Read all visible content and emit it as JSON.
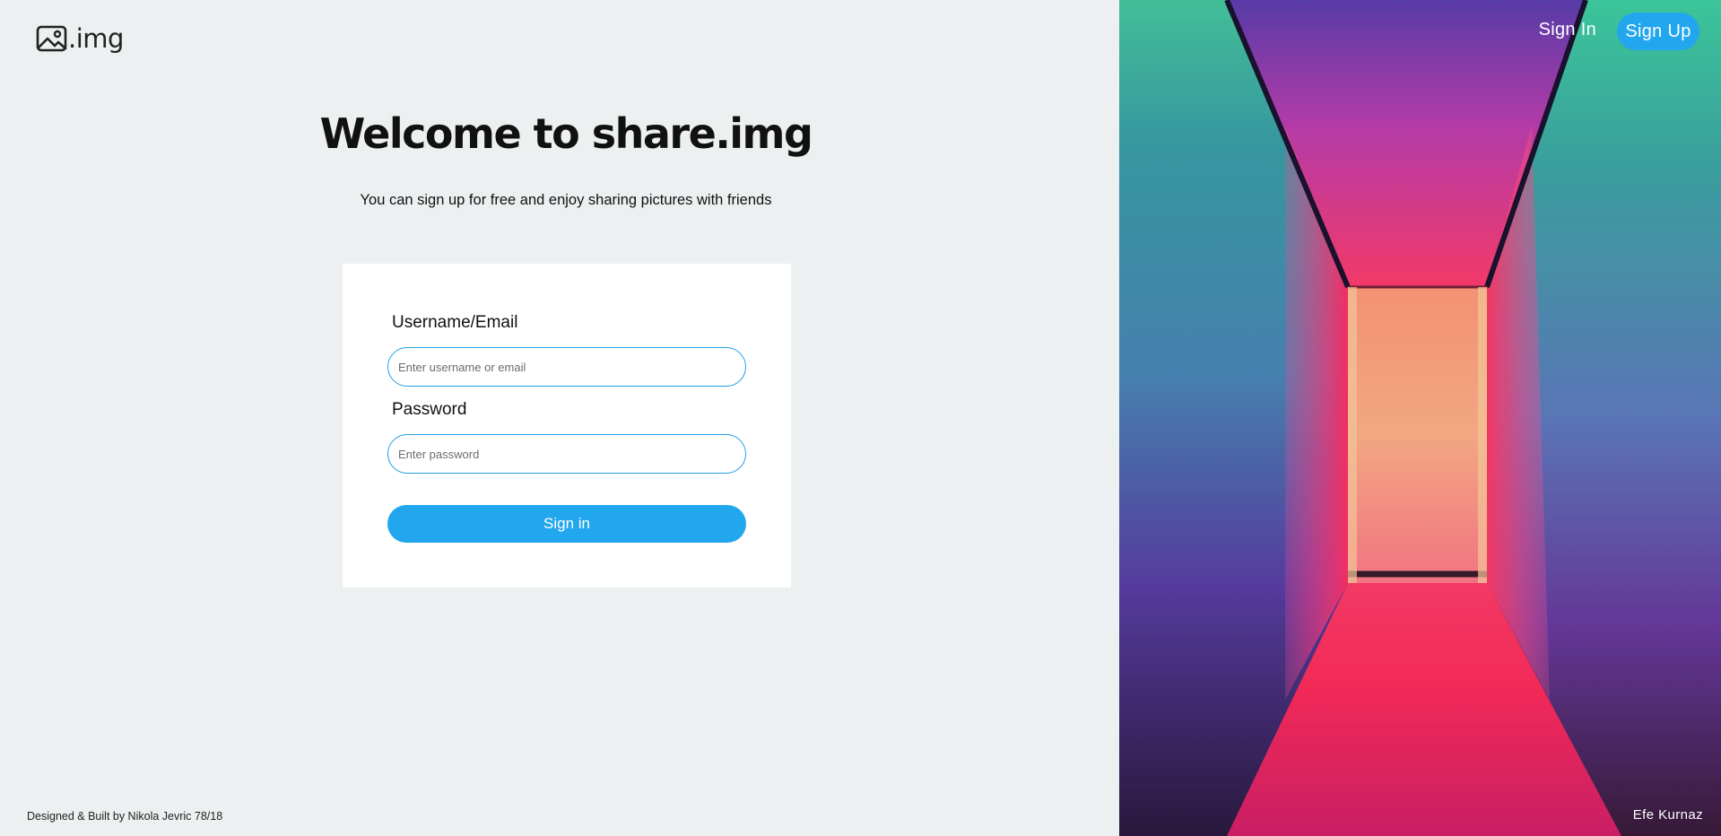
{
  "brand": {
    "logo_icon": "image-icon",
    "name": ".img"
  },
  "hero": {
    "title": "Welcome to share.img",
    "subtitle": "You can sign up for free and enjoy sharing pictures with friends"
  },
  "login_form": {
    "username_label": "Username/Email",
    "username_placeholder": "Enter username or email",
    "username_value": "",
    "password_label": "Password",
    "password_placeholder": "Enter password",
    "password_value": "",
    "submit_label": "Sign in"
  },
  "nav": {
    "sign_in": "Sign In",
    "sign_up": "Sign Up"
  },
  "footer": {
    "credit": "Designed & Built by Nikola Jevric 78/18"
  },
  "photo": {
    "credit": "Efe Kurnaz"
  },
  "colors": {
    "accent": "#22a7ee",
    "left_background": "#ecf0f1",
    "card_background": "#ffffff"
  }
}
